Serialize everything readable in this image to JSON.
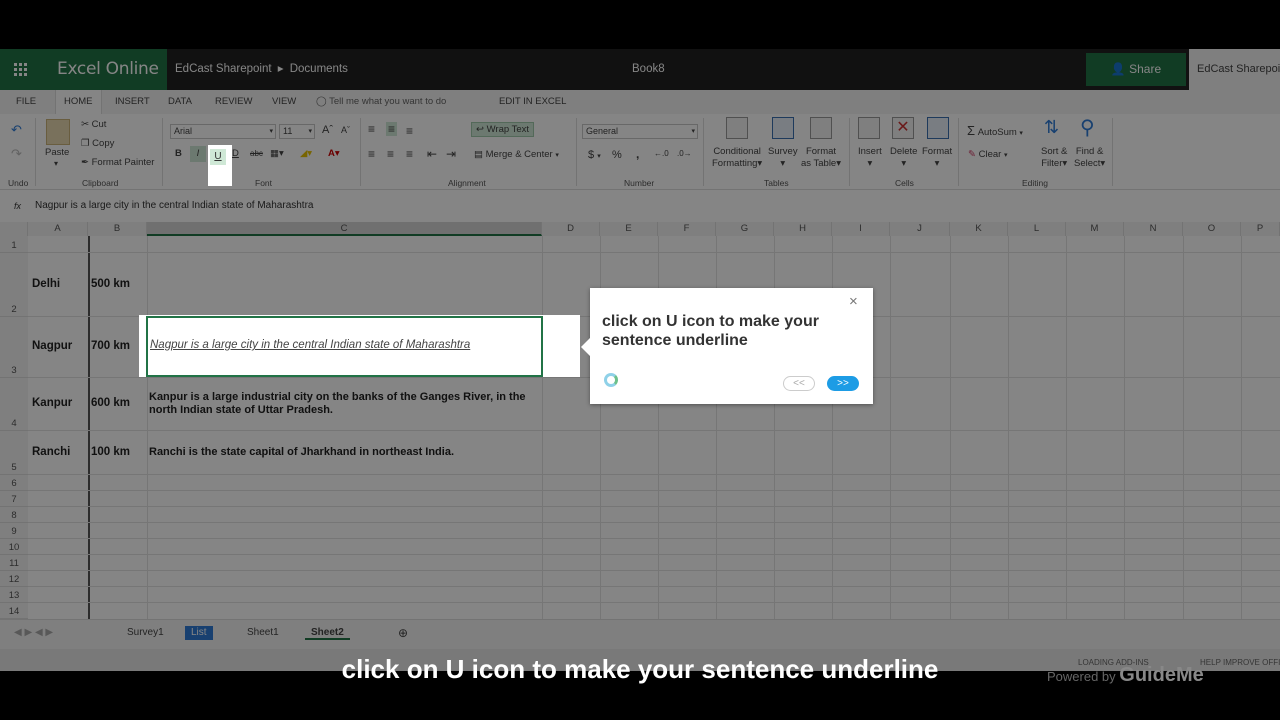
{
  "topbar": {
    "brand": "Excel Online",
    "breadcrumb_site": "EdCast Sharepoint",
    "breadcrumb_sep": "▸",
    "breadcrumb_folder": "Documents",
    "doc_title": "Book8",
    "share_label": "Share",
    "user_label": "EdCast Sharepoint"
  },
  "tabs": [
    "FILE",
    "HOME",
    "INSERT",
    "DATA",
    "REVIEW",
    "VIEW"
  ],
  "tell_me": "Tell me what you want to do",
  "edit_in_excel": "EDIT IN EXCEL",
  "ribbon": {
    "undo_group": "Undo",
    "clipboard": {
      "paste": "Paste",
      "cut": "Cut",
      "copy": "Copy",
      "format_painter": "Format Painter",
      "group": "Clipboard"
    },
    "font": {
      "name": "Arial",
      "size": "11",
      "bold": "B",
      "italic": "I",
      "underline": "U",
      "double_underline": "D",
      "strike": "abc",
      "group": "Font"
    },
    "alignment": {
      "wrap": "Wrap Text",
      "merge": "Merge & Center",
      "group": "Alignment"
    },
    "number": {
      "format": "General",
      "currency": "$",
      "percent": "%",
      "comma": ",",
      "group": "Number"
    },
    "tables": {
      "cond1": "Conditional",
      "cond2": "Formatting",
      "survey": "Survey",
      "fmt1": "Format",
      "fmt2": "as Table",
      "group": "Tables"
    },
    "cells": {
      "insert": "Insert",
      "delete": "Delete",
      "format": "Format",
      "group": "Cells"
    },
    "editing": {
      "autosum": "AutoSum",
      "clear": "Clear",
      "sort1": "Sort &",
      "sort2": "Filter",
      "find1": "Find &",
      "find2": "Select",
      "group": "Editing"
    }
  },
  "formula_bar": {
    "fx": "fx",
    "value": "Nagpur is a large city in the central Indian state of Maharashtra"
  },
  "columns": [
    "A",
    "B",
    "C",
    "D",
    "E",
    "F",
    "G",
    "H",
    "I",
    "J",
    "K",
    "L",
    "M",
    "N",
    "O",
    "P"
  ],
  "rows": [
    "1",
    "2",
    "3",
    "4",
    "5",
    "6",
    "7",
    "8",
    "9",
    "10",
    "11",
    "12",
    "13",
    "14"
  ],
  "cells": {
    "r2": {
      "a": "Delhi",
      "b": "500 km"
    },
    "r3": {
      "a": "Nagpur",
      "b": "700 km",
      "c": "Nagpur is a large city in the central Indian state of Maharashtra"
    },
    "r4": {
      "a": "Kanpur",
      "b": "600 km",
      "c": "Kanpur is a large industrial city on the banks of the Ganges River, in the north Indian state of Uttar Pradesh."
    },
    "r5": {
      "a": "Ranchi",
      "b": "100 km",
      "c": "Ranchi is the state capital of Jharkhand in northeast India."
    }
  },
  "sheets": [
    "Survey1",
    "List",
    "Sheet1",
    "Sheet2"
  ],
  "status": {
    "loading": "LOADING ADD-INS",
    "help": "HELP IMPROVE OFFI"
  },
  "tooltip": {
    "message": "click on U icon to make your sentence underline",
    "prev": "<<",
    "next": ">>",
    "close": "×"
  },
  "caption": "click on U icon to make your sentence underline",
  "powered": {
    "prefix": "Powered by",
    "brand": "GuideMe"
  }
}
